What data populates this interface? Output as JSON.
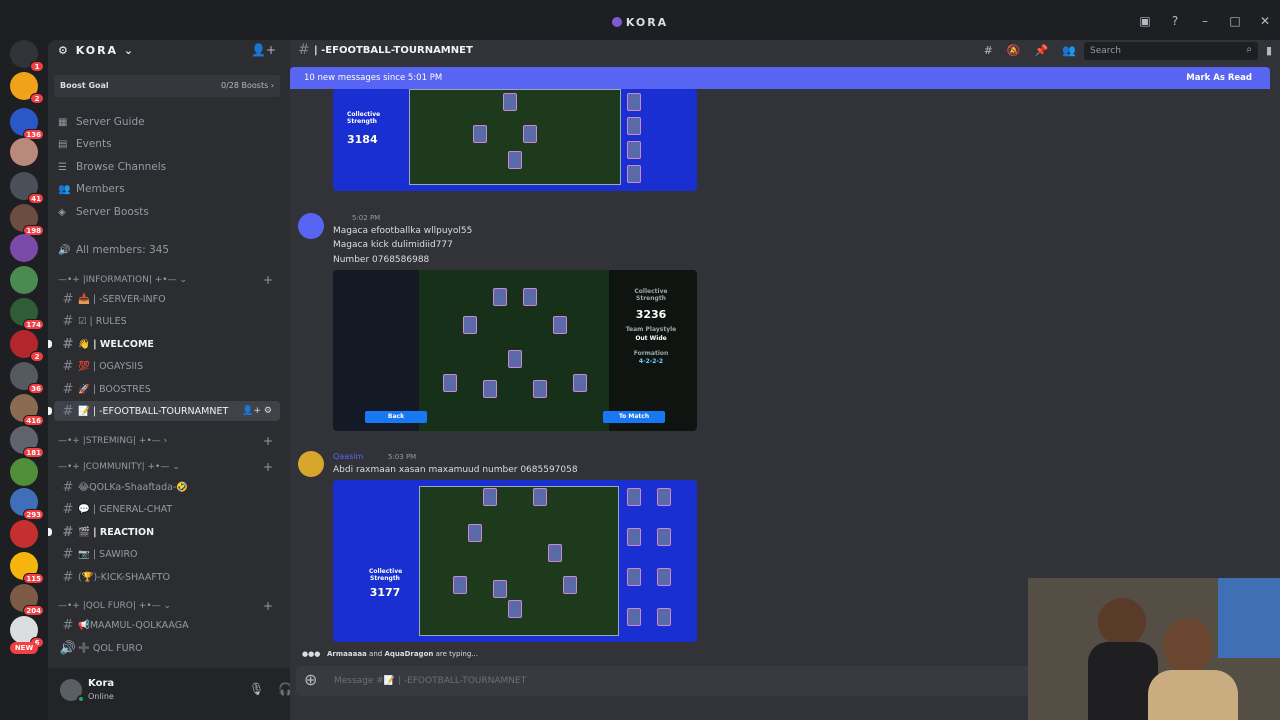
{
  "window": {
    "title": "KORA",
    "controls": [
      "inbox-icon",
      "help-icon",
      "minimize-icon",
      "maximize-icon",
      "close-icon"
    ]
  },
  "guilds": {
    "badges": [
      "1",
      "2",
      "136",
      "",
      "41",
      "198",
      "",
      "",
      "174",
      "2",
      "36",
      "2",
      "416",
      "181",
      "",
      "293",
      "",
      "115",
      "204",
      "6"
    ],
    "new_label": "NEW"
  },
  "server": {
    "name": "KORA",
    "boost_goal": {
      "label": "Boost Goal",
      "progress": "0/28 Boosts ›"
    },
    "nav": [
      {
        "label": "Server Guide",
        "icon": "guide-icon"
      },
      {
        "label": "Events",
        "icon": "calendar-icon"
      },
      {
        "label": "Browse Channels",
        "icon": "browse-icon"
      },
      {
        "label": "Members",
        "icon": "members-icon"
      },
      {
        "label": "Server Boosts",
        "icon": "boost-icon"
      }
    ],
    "all_members": "All members: 345",
    "categories": [
      {
        "label": "—•+ |INFORMATION| +•— ⌄"
      },
      {
        "label": "—•+ |STREMING| +•— ›"
      },
      {
        "label": "—•+ |COMMUNITY| +•— ⌄"
      },
      {
        "label": "—•+ |QOL FURO| +•— ⌄"
      }
    ],
    "channels": [
      {
        "label": "📥 | -SERVER-INFO"
      },
      {
        "label": "☑ | RULES"
      },
      {
        "label": "👋 | WELCOME"
      },
      {
        "label": "💯 | OGAYSIIS"
      },
      {
        "label": "🚀 | BOOSTRES"
      },
      {
        "label": "📝 | -EFOOTBALL-TOURNAMNET"
      },
      {
        "label": "😂QOLKa-Shaaftada-🤣"
      },
      {
        "label": "💬 | GENERAL-CHAT"
      },
      {
        "label": "🎬 | REACTION"
      },
      {
        "label": "📷 | SAWIRO"
      },
      {
        "label": "(🏆)-KICK-SHAAFTO"
      },
      {
        "label": "📢MAAMUL-QOLKAAGA"
      },
      {
        "label": "➕ QOL FURO"
      }
    ]
  },
  "user": {
    "name": "Kora",
    "status": "Online"
  },
  "channel": {
    "name": "| -EFOOTBALL-TOURNAMNET",
    "search_placeholder": "Search"
  },
  "new_messages": {
    "text": "10 new messages since 5:01 PM",
    "action": "Mark As Read"
  },
  "messages": [
    {
      "time": "5:02 PM",
      "lines": [
        "Magaca efootballka wllpuyol55",
        "Magaca kick dulimidiid777",
        "Number 0768586988"
      ],
      "image": {
        "strength_label": "Collective Strength",
        "strength": "3236",
        "playstyle_label": "Team Playstyle",
        "playstyle": "Out Wide",
        "formation_label": "Formation",
        "formation": "4-2-2-2",
        "back": "Back",
        "to_match": "To Match"
      }
    },
    {
      "author": "Qaasim",
      "time": "5:03 PM",
      "lines": [
        "Abdi raxmaan xasan maxamuud number  0685597058"
      ],
      "image": {
        "strength_label": "Collective Strength",
        "strength": "3177"
      }
    }
  ],
  "top_image": {
    "strength_label": "Collective Strength",
    "strength": "3184"
  },
  "typing": {
    "names": "Armaaaaa",
    "and": "and",
    "other": "AquaDragon",
    "suffix": "are typing..."
  },
  "composer": {
    "placeholder": "Message #📝 | -EFOOTBALL-TOURNAMNET"
  },
  "colors": {
    "accent": "#5865f2",
    "online": "#23a55a",
    "badge": "#f23f43"
  }
}
